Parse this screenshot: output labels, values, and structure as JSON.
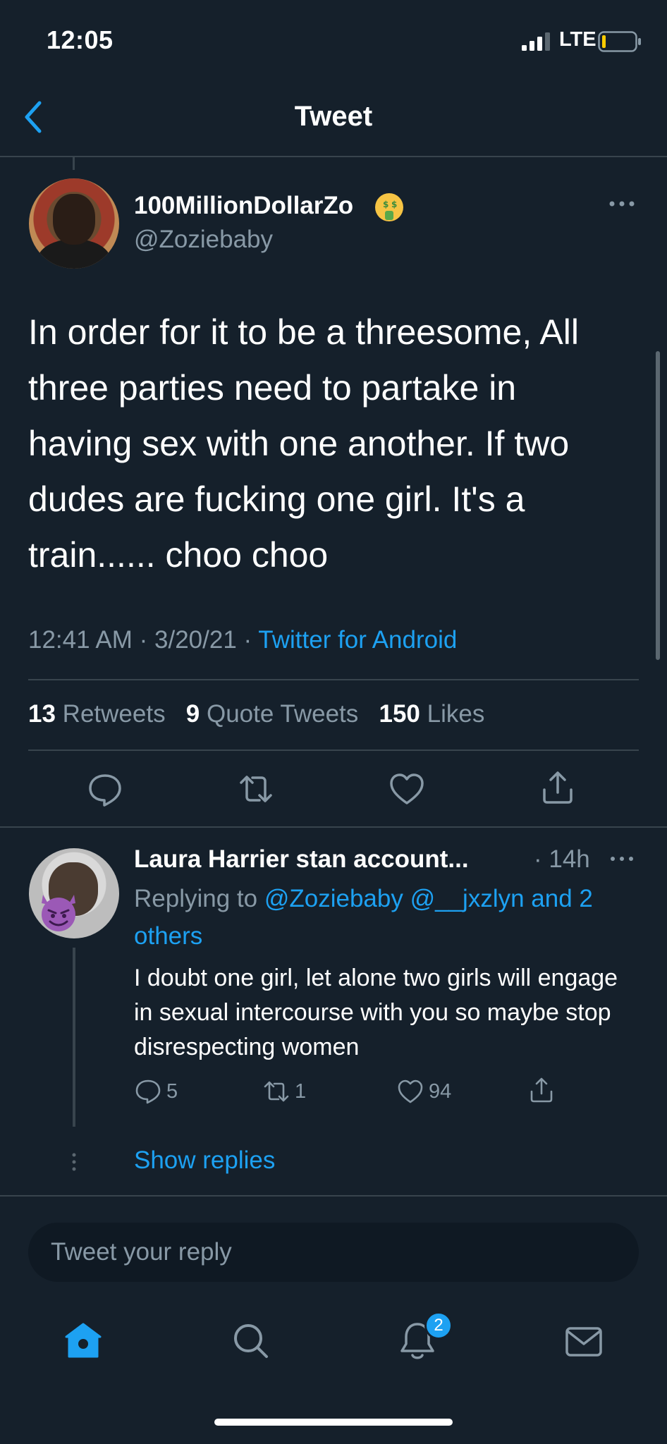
{
  "status_bar": {
    "time": "12:05",
    "network": "LTE"
  },
  "header": {
    "title": "Tweet"
  },
  "tweet": {
    "author_name": "100MillionDollarZo",
    "author_handle": "@Zoziebaby",
    "text": "In order for it to be a threesome, All three parties need to partake in having sex with one another. If two dudes are fucking one girl. It's a train...... choo choo",
    "time": "12:41 AM",
    "date": "3/20/21",
    "source": "Twitter for Android",
    "stats": {
      "retweets_count": "13",
      "retweets_label": "Retweets",
      "quotes_count": "9",
      "quotes_label": "Quote Tweets",
      "likes_count": "150",
      "likes_label": "Likes"
    }
  },
  "reply": {
    "author_name": "Laura Harrier stan account...",
    "time": "· 14h",
    "replying_prefix": "Replying to",
    "replying_to": "@Zoziebaby @__jxzlyn and 2 others",
    "text": "I doubt one girl, let alone two girls will engage in sexual intercourse with you so maybe stop disrespecting women",
    "reply_count": "5",
    "retweet_count": "1",
    "like_count": "94",
    "show_replies": "Show replies"
  },
  "composer": {
    "placeholder": "Tweet your reply"
  },
  "tabbar": {
    "notification_badge": "2"
  },
  "colors": {
    "background": "#15202b",
    "accent": "#1da1f2",
    "muted": "#8899a6",
    "divider": "#38444d"
  }
}
